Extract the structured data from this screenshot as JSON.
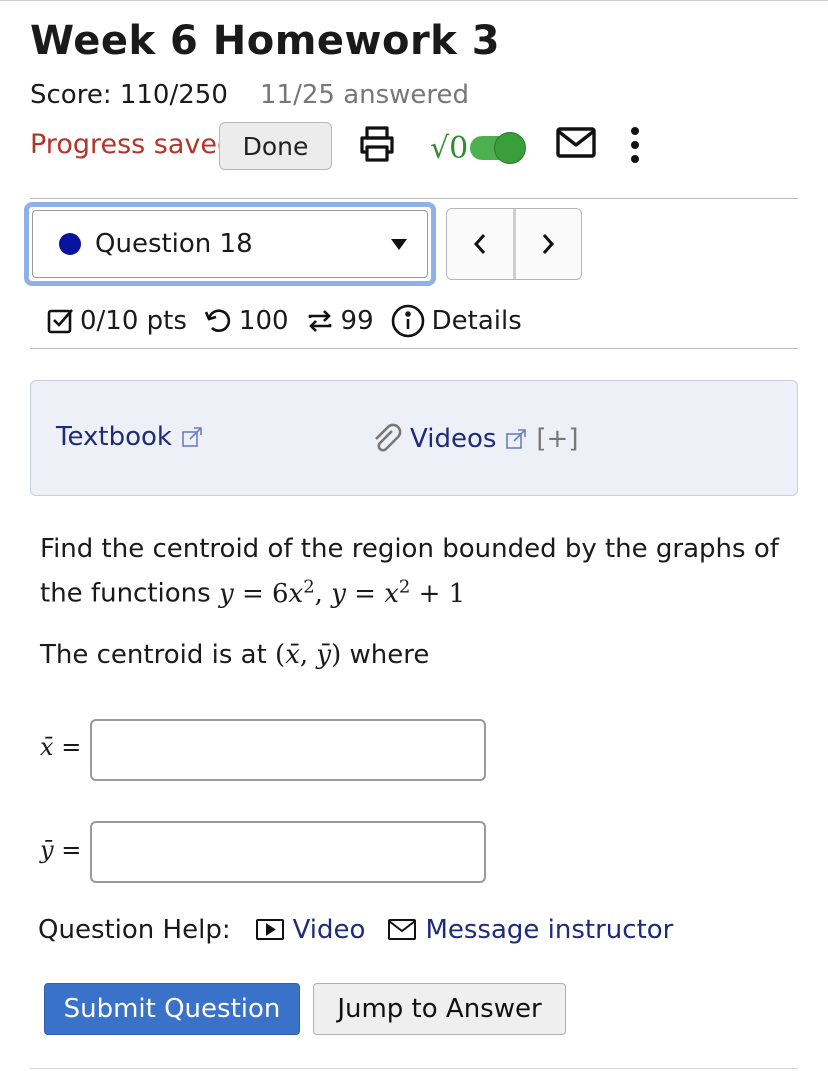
{
  "assignment": {
    "title": "Week 6 Homework 3",
    "score": "Score: 110/250",
    "answered": "11/25 answered",
    "progress_status": "Progress saved",
    "done_label": "Done"
  },
  "toolbar": {
    "icons": [
      "print-icon",
      "math-entry-toggle",
      "mail-icon",
      "more-options-icon"
    ],
    "math_toggle_symbol": "√0",
    "math_toggle_on": true
  },
  "question_nav": {
    "selected": "Question 18",
    "status_color": "#0a12a0",
    "prev_symbol": "<",
    "next_symbol": ">"
  },
  "question_meta": {
    "points": "0/10 pts",
    "retries": "100",
    "attempts": "99",
    "details_label": "Details"
  },
  "resources": {
    "textbook_label": "Textbook",
    "videos_label": "Videos",
    "expand_label": "[+]"
  },
  "question": {
    "text_line1": "Find the centroid of the region bounded by the graphs of",
    "text_line2_prefix": "the functions",
    "centroid_prefix": "The centroid is at",
    "centroid_suffix": "where",
    "xbar_label": "x̄",
    "ybar_label": "ȳ",
    "equals": "=",
    "xbar_value": "",
    "ybar_value": ""
  },
  "help": {
    "label": "Question Help:",
    "video_label": "Video",
    "message_label": "Message instructor"
  },
  "actions": {
    "submit_label": "Submit Question",
    "jump_label": "Jump to Answer"
  },
  "colors": {
    "progress_saved": "#b3342a",
    "link": "#1d2c7a",
    "submit_button": "#3b72c9",
    "toggle_on": "#4caf50"
  }
}
